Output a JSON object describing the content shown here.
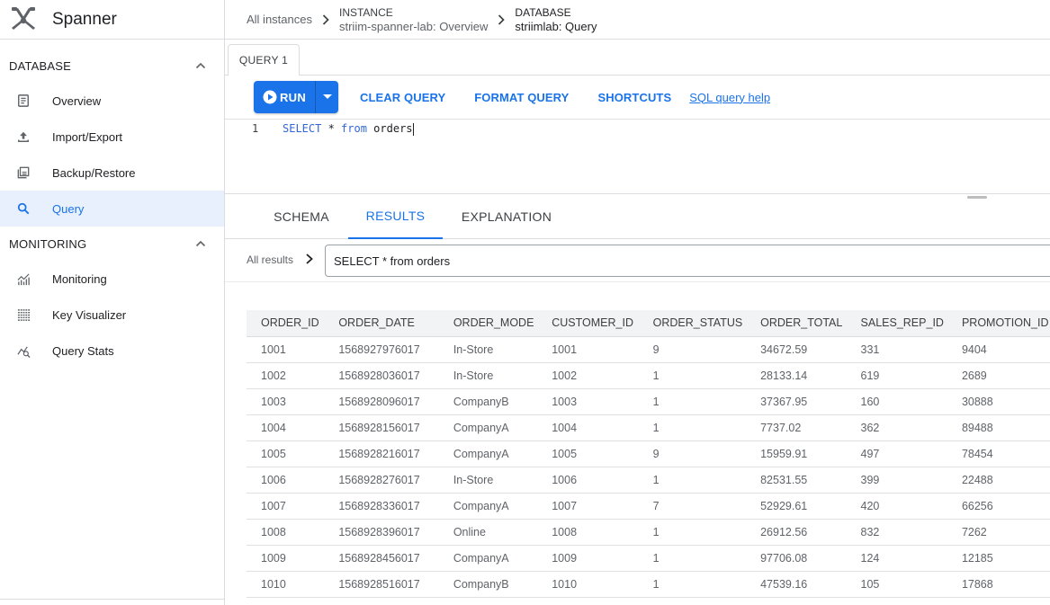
{
  "app": {
    "name": "Spanner"
  },
  "sidebar": {
    "sections": [
      {
        "label": "DATABASE",
        "items": [
          {
            "label": "Overview",
            "icon": "overview-icon"
          },
          {
            "label": "Import/Export",
            "icon": "upload-icon"
          },
          {
            "label": "Backup/Restore",
            "icon": "backup-icon"
          },
          {
            "label": "Query",
            "icon": "search-icon",
            "active": true
          }
        ]
      },
      {
        "label": "MONITORING",
        "items": [
          {
            "label": "Monitoring",
            "icon": "monitoring-chart-icon"
          },
          {
            "label": "Key Visualizer",
            "icon": "key-visualizer-icon"
          },
          {
            "label": "Query Stats",
            "icon": "query-stats-icon"
          }
        ]
      }
    ]
  },
  "breadcrumb": {
    "all_instances": "All instances",
    "instance_label": "INSTANCE",
    "instance_value": "striim-spanner-lab: Overview",
    "database_label": "DATABASE",
    "database_value": "striimlab: Query"
  },
  "query_tab": "QUERY 1",
  "toolbar": {
    "run": "RUN",
    "clear": "CLEAR QUERY",
    "format": "FORMAT QUERY",
    "shortcuts": "SHORTCUTS",
    "help": "SQL query help"
  },
  "editor": {
    "line_number": "1",
    "kw1": "SELECT",
    "star": " * ",
    "kw2": "from",
    "ident": " orders"
  },
  "result_tabs": [
    "SCHEMA",
    "RESULTS",
    "EXPLANATION"
  ],
  "results": {
    "all_results": "All results",
    "query_text": "SELECT * from orders",
    "columns": [
      "ORDER_ID",
      "ORDER_DATE",
      "ORDER_MODE",
      "CUSTOMER_ID",
      "ORDER_STATUS",
      "ORDER_TOTAL",
      "SALES_REP_ID",
      "PROMOTION_ID"
    ],
    "rows": [
      [
        "1001",
        "1568927976017",
        "In-Store",
        "1001",
        "9",
        "34672.59",
        "331",
        "9404"
      ],
      [
        "1002",
        "1568928036017",
        "In-Store",
        "1002",
        "1",
        "28133.14",
        "619",
        "2689"
      ],
      [
        "1003",
        "1568928096017",
        "CompanyB",
        "1003",
        "1",
        "37367.95",
        "160",
        "30888"
      ],
      [
        "1004",
        "1568928156017",
        "CompanyA",
        "1004",
        "1",
        "7737.02",
        "362",
        "89488"
      ],
      [
        "1005",
        "1568928216017",
        "CompanyA",
        "1005",
        "9",
        "15959.91",
        "497",
        "78454"
      ],
      [
        "1006",
        "1568928276017",
        "In-Store",
        "1006",
        "1",
        "82531.55",
        "399",
        "22488"
      ],
      [
        "1007",
        "1568928336017",
        "CompanyA",
        "1007",
        "7",
        "52929.61",
        "420",
        "66256"
      ],
      [
        "1008",
        "1568928396017",
        "Online",
        "1008",
        "1",
        "26912.56",
        "832",
        "7262"
      ],
      [
        "1009",
        "1568928456017",
        "CompanyA",
        "1009",
        "1",
        "97706.08",
        "124",
        "12185"
      ],
      [
        "1010",
        "1568928516017",
        "CompanyB",
        "1010",
        "1",
        "47539.16",
        "105",
        "17868"
      ]
    ]
  },
  "colors": {
    "accent": "#1a73e8",
    "active_bg": "#e8f0fe"
  }
}
